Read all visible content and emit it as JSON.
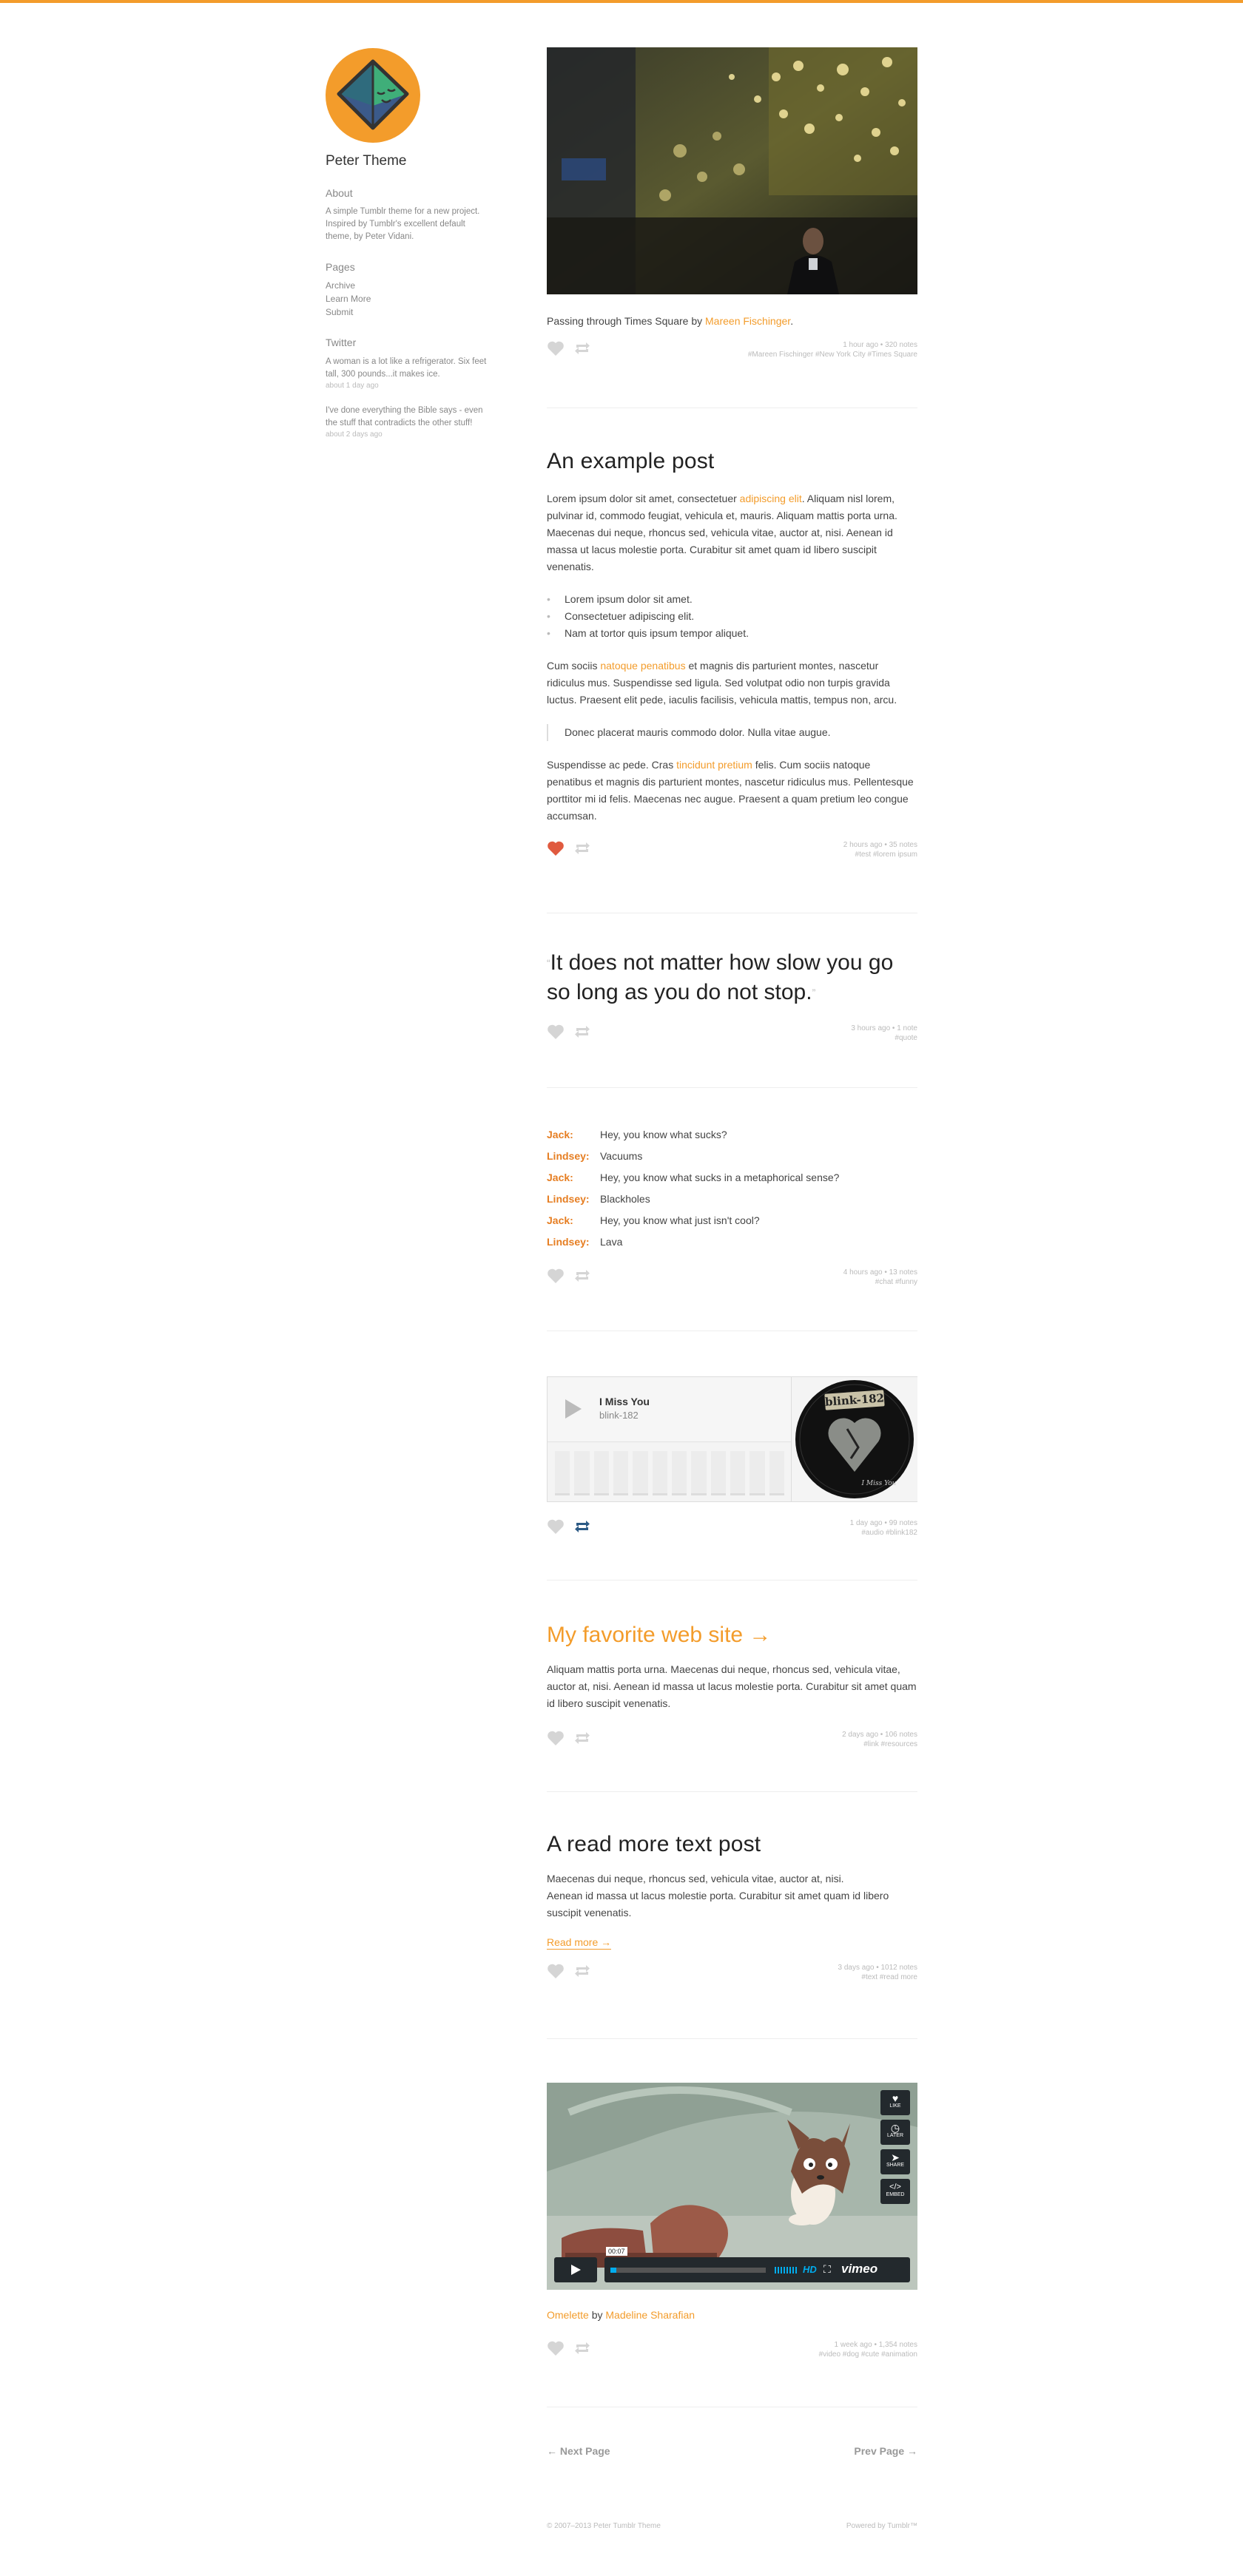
{
  "colors": {
    "accent": "#f39c2b",
    "liked": "#e05a3f",
    "reblogged": "#2c5a85"
  },
  "sidebar": {
    "blog_title": "Peter Theme",
    "about_heading": "About",
    "about_text": "A simple Tumblr theme for a new project. Inspired by Tumblr's excellent default theme, by Peter Vidani.",
    "pages_heading": "Pages",
    "pages": [
      "Archive",
      "Learn More",
      "Submit"
    ],
    "twitter_heading": "Twitter",
    "tweets": [
      {
        "text": "A woman is a lot like a refrigerator. Six feet tall, 300 pounds...it makes ice.",
        "time": "about 1 day ago"
      },
      {
        "text": "I've done everything the Bible says - even the stuff that contradicts the other stuff!",
        "time": "about 2 days ago"
      }
    ]
  },
  "posts": {
    "photo": {
      "caption_prefix": "Passing through Times Square by ",
      "caption_author": "Mareen Fischinger",
      "caption_suffix": ".",
      "meta_line1": "1 hour ago • 320 notes",
      "meta_line2": "#Mareen Fischinger #New York City #Times Square"
    },
    "text": {
      "title": "An example post",
      "p1_a": "Lorem ipsum dolor sit amet, consectetuer ",
      "p1_link": "adipiscing elit",
      "p1_b": ". Aliquam nisl lorem, pulvinar id, commodo feugiat, vehicula et, mauris. Aliquam mattis porta urna. Maecenas dui neque, rhoncus sed, vehicula vitae, auctor at, nisi. Aenean id massa ut lacus molestie porta. Curabitur sit amet quam id libero suscipit venenatis.",
      "list": [
        "Lorem ipsum dolor sit amet.",
        "Consectetuer adipiscing elit.",
        "Nam at tortor quis ipsum tempor aliquet."
      ],
      "p2_a": "Cum sociis ",
      "p2_link": "natoque penatibus",
      "p2_b": " et magnis dis parturient montes, nascetur ridiculus mus. Suspendisse sed ligula. Sed volutpat odio non turpis gravida luctus. Praesent elit pede, iaculis facilisis, vehicula mattis, tempus non, arcu.",
      "blockquote": "Donec placerat mauris commodo dolor. Nulla vitae augue.",
      "p3_a": "Suspendisse ac pede. Cras ",
      "p3_link": "tincidunt pretium",
      "p3_b": " felis. Cum sociis natoque penatibus et magnis dis parturient montes, nascetur ridiculus mus. Pellentesque porttitor mi id felis. Maecenas nec augue. Praesent a quam pretium leo congue accumsan.",
      "meta_line1": "2 hours ago • 35 notes",
      "meta_line2": "#test #lorem ipsum"
    },
    "quote": {
      "text": "It does not matter how slow you go so long as you do not stop.",
      "meta_line1": "3 hours ago • 1 note",
      "meta_line2": "#quote"
    },
    "chat": {
      "lines": [
        {
          "name": "Jack:",
          "text": "Hey, you know what sucks?"
        },
        {
          "name": "Lindsey:",
          "text": "Vacuums"
        },
        {
          "name": "Jack:",
          "text": "Hey, you know what sucks in a metaphorical sense?"
        },
        {
          "name": "Lindsey:",
          "text": "Blackholes"
        },
        {
          "name": "Jack:",
          "text": "Hey, you know what just isn't cool?"
        },
        {
          "name": "Lindsey:",
          "text": "Lava"
        }
      ],
      "meta_line1": "4 hours ago • 13 notes",
      "meta_line2": "#chat #funny"
    },
    "audio": {
      "track": "I Miss You",
      "artist": "blink-182",
      "album_label": "blink-182",
      "album_script": "I Miss You",
      "meta_line1": "1 day ago • 99 notes",
      "meta_line2": "#audio #blink182"
    },
    "link": {
      "title": "My favorite web site →",
      "body": "Aliquam mattis porta urna. Maecenas dui neque, rhoncus sed, vehicula vitae, auctor at, nisi. Aenean id massa ut lacus molestie porta. Curabitur sit amet quam id libero suscipit venenatis.",
      "meta_line1": "2 days ago • 106 notes",
      "meta_line2": "#link #resources"
    },
    "readmore": {
      "title": "A read more text post",
      "body_line1": "Maecenas dui neque, rhoncus sed, vehicula vitae, auctor at, nisi.",
      "body_line2": "Aenean id massa ut lacus molestie porta. Curabitur sit amet quam id libero suscipit venenatis.",
      "read_more": "Read more →",
      "meta_line1": "3 days ago • 1012 notes",
      "meta_line2": "#text #read more"
    },
    "video": {
      "time": "00:07",
      "side_buttons": [
        "LIKE",
        "LATER",
        "SHARE",
        "EMBED"
      ],
      "hd": "HD",
      "brand": "vimeo",
      "caption_title": "Omelette",
      "caption_by": " by ",
      "caption_author": "Madeline Sharafian",
      "meta_line1": "1 week ago • 1,354 notes",
      "meta_line2": "#video #dog #cute #animation"
    }
  },
  "pager": {
    "next": "← Next Page",
    "prev": "Prev Page →"
  },
  "footer": {
    "copyright": "© 2007–2013 Peter Tumblr Theme",
    "powered": "Powered by Tumblr™"
  }
}
